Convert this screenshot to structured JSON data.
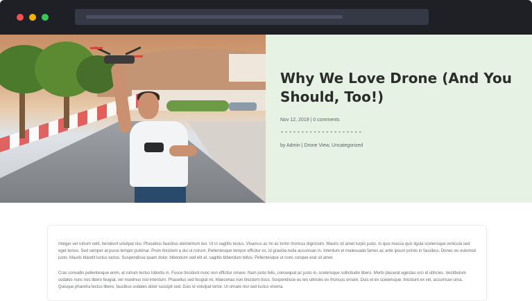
{
  "browser": {
    "controls": [
      "close",
      "minimize",
      "maximize"
    ],
    "url": ""
  },
  "hero": {
    "image_alt": "Man flying a drone on a palm-lined road",
    "title": "Why We Love Drone (And You Should, Too!)",
    "meta": "Nov 12, 2019 | 0 comments",
    "divider": "--------------------",
    "byline": "by Admin | Drone View, Uncategorized",
    "panel_color": "#e6f2e4"
  },
  "content": {
    "paragraphs": [
      "Integer vel rutrum velit, hendrerit volutpat nisi. Phasellus faucibus elementum leo. Ut in sagittis lectus. Vivamus ac mi ac tortor rhoncus dignissim. Mauris sit amet turpis justo. In quis massa quis ligula scelerisque vehicula sed eget lectus. Sed semper at purus tempor pulvinar. Proin tincidunt a dui ut rutrum. Pellentesque tempor efficitur ex, id gravida nulla accumsan in. Interdum et malesuada fames ac ante ipsum primis in faucibus. Donec eu euismod justo. Mauris blandit luctus luctus. Suspendisse quam dolor, bibendum sed elit at, sagittis bibendum tellus. Pellentesque ut nunc congue erat sit amet.",
      "Cras convallis pellentesque enim, at rutrum lectus lobortis in. Fusce tincidunt nunc non efficitur ornare. Nam justo felis, consequat ac justo in, scelerisque sollicitudin libero. Morbi placerat egestas orci id ultricies. Vestibulum sodales nunc nec libero feugiat, vel maximus nisl interdum. Phasellus sed feugiat mi. Maecenas non tincidunt risus. Suspendisse eu leo ultricies ex rhoncus ornare. Duis et ex scelerisque, tincidunt ex vel, accumsan urna. Quisque pharetra lectus libero, faucibus sodales dolor suscipit sed. Duis id volutpat tortor. Ut ornare nisl sed luctus viverra."
    ]
  }
}
